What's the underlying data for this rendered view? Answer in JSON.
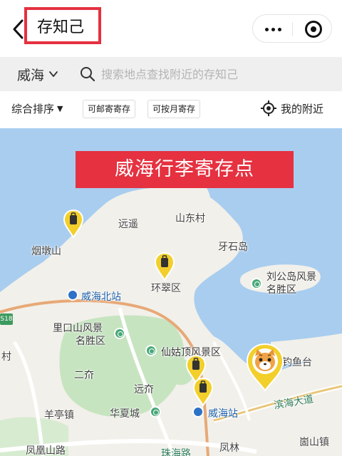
{
  "nav": {
    "title": "存知己"
  },
  "search": {
    "city": "威海",
    "placeholder": "搜索地点查找附近的存知己"
  },
  "filters": {
    "sort_label": "综合排序",
    "sort_caret": "▼",
    "chip_mail": "可邮寄寄存",
    "chip_monthly": "可按月寄存",
    "nearby_label": "我的附近"
  },
  "map": {
    "banner": "威海行李寄存点",
    "labels": {
      "yuanyao": "远遥",
      "shandongcun": "山东村",
      "yantunshan": "烟墩山",
      "yashidao": "牙石岛",
      "liugongdao_1": "刘公岛风景",
      "liugongdao_2": "名胜区",
      "huancui": "环翠区",
      "weihai_north": "威海北站",
      "likoushan_1": "里口山风景",
      "likoushan_2": "名胜区",
      "xianguding": "仙姑顶风景区",
      "diaoyutai": "钓鱼台",
      "cun": "村",
      "erqi": "二夼",
      "yuanqi": "远夼",
      "huaxiacheng": "华夏城",
      "weihai_station": "威海站",
      "binhai": "滨海大道",
      "yangting": "羊亭镇",
      "fenghuangshan": "凤凰山路",
      "fenglin": "凤林",
      "yaoshan": "崮山镇",
      "zhuhai": "珠海路",
      "route_shield": "S18"
    }
  },
  "colors": {
    "accent": "#e53140",
    "water": "#a8cdef",
    "land": "#f2f0ea",
    "park": "#c6e4c0",
    "pin_gold": "#f2cf2b"
  }
}
